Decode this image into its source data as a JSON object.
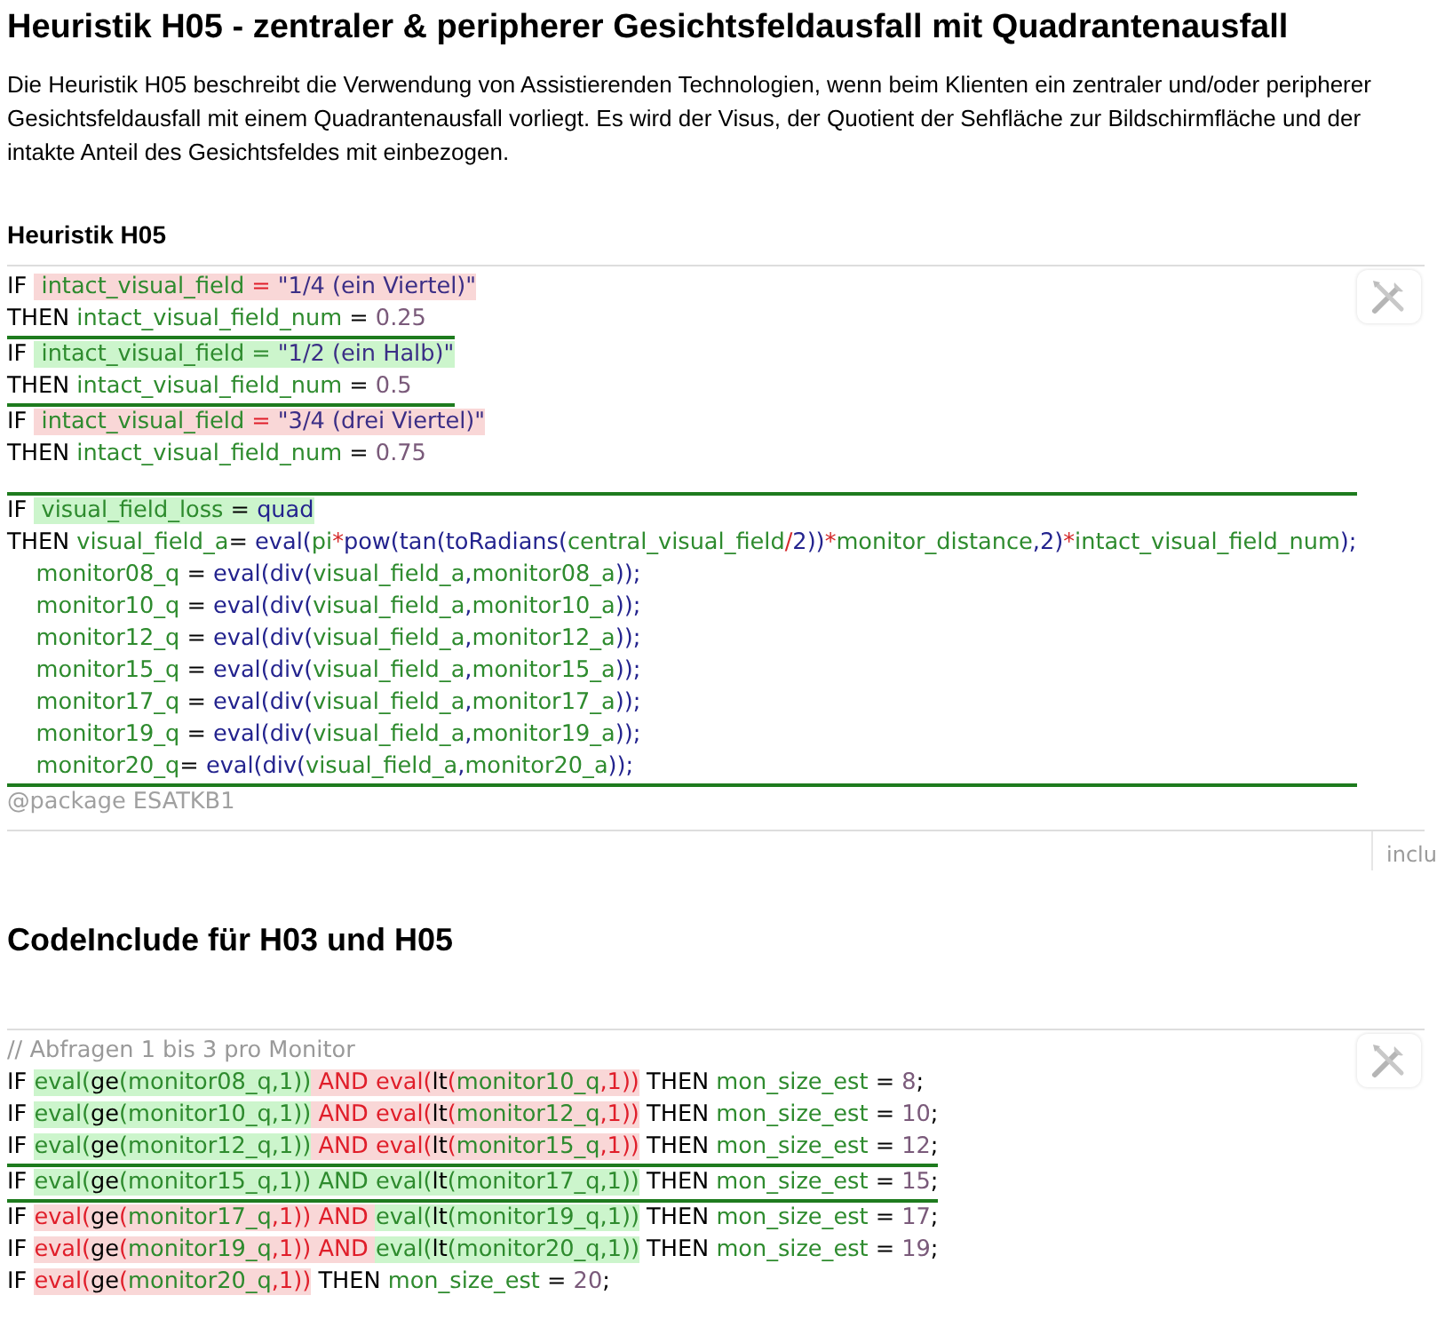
{
  "title": "Heuristik H05 - zentraler & peripherer Gesichtsfeldausfall mit Quadrantenausfall",
  "description": "Die Heuristik H05 beschreibt die Verwendung von Assistierenden Technologien, wenn beim Klienten ein zentraler und/oder peripherer Gesichtsfeldausfall mit einem Quadrantenausfall vorliegt. Es wird der Visus, der Quotient der Sehfläche zur Bildschirmfläche und der intakte Anteil des Gesichtsfeldes mit einbezogen.",
  "sections": [
    {
      "heading": "Heuristik H05",
      "kind": "subheading",
      "tab": "inclu",
      "footer": "@package ESATKB1",
      "blocks": [
        [
          {
            "fired": false,
            "lines": [
              [
                {
                  "text": "IF ",
                  "kind": "keyword"
                },
                {
                  "text": " intact_visual_field",
                  "kind": "variable",
                  "passed": false
                },
                {
                  "text": " = ",
                  "kind": "mark",
                  "passed": false
                },
                {
                  "text": "\"1/4 (ein Viertel)\"",
                  "kind": "string",
                  "passed": false
                }
              ],
              [
                {
                  "text": "THEN ",
                  "kind": "keyword"
                },
                {
                  "text": "intact_visual_field_num",
                  "kind": "variable"
                },
                {
                  "text": " = ",
                  "kind": "keyword"
                },
                {
                  "text": "0.25",
                  "kind": "number"
                }
              ]
            ]
          },
          {
            "fired": true,
            "lines": [
              [
                {
                  "text": "IF ",
                  "kind": "keyword"
                },
                {
                  "text": " intact_visual_field",
                  "kind": "variable",
                  "passed": true
                },
                {
                  "text": " = ",
                  "kind": "mark",
                  "passed": true
                },
                {
                  "text": "\"1/2 (ein Halb)\"",
                  "kind": "string",
                  "passed": true
                }
              ],
              [
                {
                  "text": "THEN ",
                  "kind": "keyword"
                },
                {
                  "text": "intact_visual_field_num",
                  "kind": "variable"
                },
                {
                  "text": " = ",
                  "kind": "keyword"
                },
                {
                  "text": "0.5",
                  "kind": "number"
                }
              ]
            ]
          },
          {
            "fired": false,
            "lines": [
              [
                {
                  "text": "IF ",
                  "kind": "keyword"
                },
                {
                  "text": " intact_visual_field",
                  "kind": "variable",
                  "passed": false
                },
                {
                  "text": " = ",
                  "kind": "mark",
                  "passed": false
                },
                {
                  "text": "\"3/4 (drei Viertel)\"",
                  "kind": "string",
                  "passed": false
                }
              ],
              [
                {
                  "text": "THEN ",
                  "kind": "keyword"
                },
                {
                  "text": "intact_visual_field_num",
                  "kind": "variable"
                },
                {
                  "text": " = ",
                  "kind": "keyword"
                },
                {
                  "text": "0.75",
                  "kind": "number"
                }
              ]
            ]
          }
        ],
        [
          {
            "fired": true,
            "lines": [
              [
                {
                  "text": "IF ",
                  "kind": "keyword"
                },
                {
                  "text": " visual_field_loss",
                  "kind": "variable",
                  "passed": true
                },
                {
                  "text": " = ",
                  "kind": "keyword",
                  "passed": true
                },
                {
                  "text": "quad",
                  "kind": "function",
                  "passed": true
                }
              ],
              [
                {
                  "text": "THEN ",
                  "kind": "keyword"
                },
                {
                  "text": "visual_field_a",
                  "kind": "variable"
                },
                {
                  "text": "= ",
                  "kind": "keyword"
                },
                {
                  "text": "eval(",
                  "kind": "function"
                },
                {
                  "text": "pi",
                  "kind": "variable"
                },
                {
                  "text": "*",
                  "kind": "operator"
                },
                {
                  "text": "pow(tan(toRadians(",
                  "kind": "function"
                },
                {
                  "text": "central_visual_field",
                  "kind": "variable"
                },
                {
                  "text": "/",
                  "kind": "operator"
                },
                {
                  "text": "2))",
                  "kind": "function"
                },
                {
                  "text": "*",
                  "kind": "operator"
                },
                {
                  "text": "monitor_distance",
                  "kind": "variable"
                },
                {
                  "text": ",2)",
                  "kind": "function"
                },
                {
                  "text": "*",
                  "kind": "operator"
                },
                {
                  "text": "intact_visual_field_num",
                  "kind": "variable"
                },
                {
                  "text": ");",
                  "kind": "function"
                }
              ],
              [
                {
                  "text": "    monitor08_q",
                  "kind": "variable"
                },
                {
                  "text": " = ",
                  "kind": "keyword"
                },
                {
                  "text": "eval(div(",
                  "kind": "function"
                },
                {
                  "text": "visual_field_a",
                  "kind": "variable"
                },
                {
                  "text": ",",
                  "kind": "function"
                },
                {
                  "text": "monitor08_a",
                  "kind": "variable"
                },
                {
                  "text": "));",
                  "kind": "function"
                }
              ],
              [
                {
                  "text": "    monitor10_q",
                  "kind": "variable"
                },
                {
                  "text": " = ",
                  "kind": "keyword"
                },
                {
                  "text": "eval(div(",
                  "kind": "function"
                },
                {
                  "text": "visual_field_a",
                  "kind": "variable"
                },
                {
                  "text": ",",
                  "kind": "function"
                },
                {
                  "text": "monitor10_a",
                  "kind": "variable"
                },
                {
                  "text": "));",
                  "kind": "function"
                }
              ],
              [
                {
                  "text": "    monitor12_q",
                  "kind": "variable"
                },
                {
                  "text": " = ",
                  "kind": "keyword"
                },
                {
                  "text": "eval(div(",
                  "kind": "function"
                },
                {
                  "text": "visual_field_a",
                  "kind": "variable"
                },
                {
                  "text": ",",
                  "kind": "function"
                },
                {
                  "text": "monitor12_a",
                  "kind": "variable"
                },
                {
                  "text": "));",
                  "kind": "function"
                }
              ],
              [
                {
                  "text": "    monitor15_q",
                  "kind": "variable"
                },
                {
                  "text": " = ",
                  "kind": "keyword"
                },
                {
                  "text": "eval(div(",
                  "kind": "function"
                },
                {
                  "text": "visual_field_a",
                  "kind": "variable"
                },
                {
                  "text": ",",
                  "kind": "function"
                },
                {
                  "text": "monitor15_a",
                  "kind": "variable"
                },
                {
                  "text": "));",
                  "kind": "function"
                }
              ],
              [
                {
                  "text": "    monitor17_q",
                  "kind": "variable"
                },
                {
                  "text": " = ",
                  "kind": "keyword"
                },
                {
                  "text": "eval(div(",
                  "kind": "function"
                },
                {
                  "text": "visual_field_a",
                  "kind": "variable"
                },
                {
                  "text": ",",
                  "kind": "function"
                },
                {
                  "text": "monitor17_a",
                  "kind": "variable"
                },
                {
                  "text": "));",
                  "kind": "function"
                }
              ],
              [
                {
                  "text": "    monitor19_q",
                  "kind": "variable"
                },
                {
                  "text": " = ",
                  "kind": "keyword"
                },
                {
                  "text": "eval(div(",
                  "kind": "function"
                },
                {
                  "text": "visual_field_a",
                  "kind": "variable"
                },
                {
                  "text": ",",
                  "kind": "function"
                },
                {
                  "text": "monitor19_a",
                  "kind": "variable"
                },
                {
                  "text": "));",
                  "kind": "function"
                }
              ],
              [
                {
                  "text": "    monitor20_q",
                  "kind": "variable"
                },
                {
                  "text": "= ",
                  "kind": "keyword"
                },
                {
                  "text": "eval(div(",
                  "kind": "function"
                },
                {
                  "text": "visual_field_a",
                  "kind": "variable"
                },
                {
                  "text": ",",
                  "kind": "function"
                },
                {
                  "text": "monitor20_a",
                  "kind": "variable"
                },
                {
                  "text": "));",
                  "kind": "function"
                }
              ]
            ]
          }
        ]
      ]
    },
    {
      "heading": "CodeInclude für H03 und H05",
      "kind": "heading",
      "blocks": [
        [
          {
            "fired": false,
            "lines": [
              [
                {
                  "text": "// Abfragen 1 bis 3 pro Monitor",
                  "kind": "comment"
                }
              ],
              [
                {
                  "text": "IF ",
                  "kind": "keyword"
                },
                {
                  "text": "eval(",
                  "kind": "mark",
                  "passed": true
                },
                {
                  "text": "ge",
                  "kind": "keyword",
                  "passed": true
                },
                {
                  "text": "(",
                  "kind": "mark",
                  "passed": true
                },
                {
                  "text": "monitor08_q",
                  "kind": "variable",
                  "passed": true
                },
                {
                  "text": ",1))",
                  "kind": "mark",
                  "passed": true
                },
                {
                  "text": " AND eval(",
                  "kind": "mark",
                  "passed": false
                },
                {
                  "text": "lt",
                  "kind": "keyword",
                  "passed": false
                },
                {
                  "text": "(",
                  "kind": "mark",
                  "passed": false
                },
                {
                  "text": "monitor10_q",
                  "kind": "variable",
                  "passed": false
                },
                {
                  "text": ",1))",
                  "kind": "mark",
                  "passed": false
                },
                {
                  "text": " THEN ",
                  "kind": "keyword"
                },
                {
                  "text": "mon_size_est",
                  "kind": "variable"
                },
                {
                  "text": " = ",
                  "kind": "keyword"
                },
                {
                  "text": "8",
                  "kind": "number"
                },
                {
                  "text": ";",
                  "kind": "keyword"
                }
              ],
              [
                {
                  "text": "IF ",
                  "kind": "keyword"
                },
                {
                  "text": "eval(",
                  "kind": "mark",
                  "passed": true
                },
                {
                  "text": "ge",
                  "kind": "keyword",
                  "passed": true
                },
                {
                  "text": "(",
                  "kind": "mark",
                  "passed": true
                },
                {
                  "text": "monitor10_q",
                  "kind": "variable",
                  "passed": true
                },
                {
                  "text": ",1))",
                  "kind": "mark",
                  "passed": true
                },
                {
                  "text": " AND eval(",
                  "kind": "mark",
                  "passed": false
                },
                {
                  "text": "lt",
                  "kind": "keyword",
                  "passed": false
                },
                {
                  "text": "(",
                  "kind": "mark",
                  "passed": false
                },
                {
                  "text": "monitor12_q",
                  "kind": "variable",
                  "passed": false
                },
                {
                  "text": ",1))",
                  "kind": "mark",
                  "passed": false
                },
                {
                  "text": " THEN ",
                  "kind": "keyword"
                },
                {
                  "text": "mon_size_est",
                  "kind": "variable"
                },
                {
                  "text": " = ",
                  "kind": "keyword"
                },
                {
                  "text": "10",
                  "kind": "number"
                },
                {
                  "text": ";",
                  "kind": "keyword"
                }
              ],
              [
                {
                  "text": "IF ",
                  "kind": "keyword"
                },
                {
                  "text": "eval(",
                  "kind": "mark",
                  "passed": true
                },
                {
                  "text": "ge",
                  "kind": "keyword",
                  "passed": true
                },
                {
                  "text": "(",
                  "kind": "mark",
                  "passed": true
                },
                {
                  "text": "monitor12_q",
                  "kind": "variable",
                  "passed": true
                },
                {
                  "text": ",1))",
                  "kind": "mark",
                  "passed": true
                },
                {
                  "text": " AND eval(",
                  "kind": "mark",
                  "passed": false
                },
                {
                  "text": "lt",
                  "kind": "keyword",
                  "passed": false
                },
                {
                  "text": "(",
                  "kind": "mark",
                  "passed": false
                },
                {
                  "text": "monitor15_q",
                  "kind": "variable",
                  "passed": false
                },
                {
                  "text": ",1))",
                  "kind": "mark",
                  "passed": false
                },
                {
                  "text": " THEN ",
                  "kind": "keyword"
                },
                {
                  "text": "mon_size_est",
                  "kind": "variable"
                },
                {
                  "text": " = ",
                  "kind": "keyword"
                },
                {
                  "text": "12",
                  "kind": "number"
                },
                {
                  "text": ";",
                  "kind": "keyword"
                }
              ]
            ]
          },
          {
            "fired": true,
            "lines": [
              [
                {
                  "text": "IF ",
                  "kind": "keyword"
                },
                {
                  "text": "eval(",
                  "kind": "mark",
                  "passed": true
                },
                {
                  "text": "ge",
                  "kind": "keyword",
                  "passed": true
                },
                {
                  "text": "(",
                  "kind": "mark",
                  "passed": true
                },
                {
                  "text": "monitor15_q",
                  "kind": "variable",
                  "passed": true
                },
                {
                  "text": ",1))",
                  "kind": "mark",
                  "passed": true
                },
                {
                  "text": " AND eval(",
                  "kind": "mark",
                  "passed": true
                },
                {
                  "text": "lt",
                  "kind": "keyword",
                  "passed": true
                },
                {
                  "text": "(",
                  "kind": "mark",
                  "passed": true
                },
                {
                  "text": "monitor17_q",
                  "kind": "variable",
                  "passed": true
                },
                {
                  "text": ",1))",
                  "kind": "mark",
                  "passed": true
                },
                {
                  "text": " THEN ",
                  "kind": "keyword"
                },
                {
                  "text": "mon_size_est",
                  "kind": "variable"
                },
                {
                  "text": " = ",
                  "kind": "keyword"
                },
                {
                  "text": "15",
                  "kind": "number"
                },
                {
                  "text": ";",
                  "kind": "keyword"
                }
              ]
            ]
          },
          {
            "fired": false,
            "lines": [
              [
                {
                  "text": "IF ",
                  "kind": "keyword"
                },
                {
                  "text": "eval(",
                  "kind": "mark",
                  "passed": false
                },
                {
                  "text": "ge",
                  "kind": "keyword",
                  "passed": false
                },
                {
                  "text": "(",
                  "kind": "mark",
                  "passed": false
                },
                {
                  "text": "monitor17_q",
                  "kind": "variable",
                  "passed": false
                },
                {
                  "text": ",1))",
                  "kind": "mark",
                  "passed": false
                },
                {
                  "text": " AND ",
                  "kind": "mark",
                  "passed": false
                },
                {
                  "text": "eval(",
                  "kind": "mark",
                  "passed": true
                },
                {
                  "text": "lt",
                  "kind": "keyword",
                  "passed": true
                },
                {
                  "text": "(",
                  "kind": "mark",
                  "passed": true
                },
                {
                  "text": "monitor19_q",
                  "kind": "variable",
                  "passed": true
                },
                {
                  "text": ",1))",
                  "kind": "mark",
                  "passed": true
                },
                {
                  "text": " THEN ",
                  "kind": "keyword"
                },
                {
                  "text": "mon_size_est",
                  "kind": "variable"
                },
                {
                  "text": " = ",
                  "kind": "keyword"
                },
                {
                  "text": "17",
                  "kind": "number"
                },
                {
                  "text": ";",
                  "kind": "keyword"
                }
              ],
              [
                {
                  "text": "IF ",
                  "kind": "keyword"
                },
                {
                  "text": "eval(",
                  "kind": "mark",
                  "passed": false
                },
                {
                  "text": "ge",
                  "kind": "keyword",
                  "passed": false
                },
                {
                  "text": "(",
                  "kind": "mark",
                  "passed": false
                },
                {
                  "text": "monitor19_q",
                  "kind": "variable",
                  "passed": false
                },
                {
                  "text": ",1))",
                  "kind": "mark",
                  "passed": false
                },
                {
                  "text": " AND ",
                  "kind": "mark",
                  "passed": false
                },
                {
                  "text": "eval(",
                  "kind": "mark",
                  "passed": true
                },
                {
                  "text": "lt",
                  "kind": "keyword",
                  "passed": true
                },
                {
                  "text": "(",
                  "kind": "mark",
                  "passed": true
                },
                {
                  "text": "monitor20_q",
                  "kind": "variable",
                  "passed": true
                },
                {
                  "text": ",1))",
                  "kind": "mark",
                  "passed": true
                },
                {
                  "text": " THEN ",
                  "kind": "keyword"
                },
                {
                  "text": "mon_size_est",
                  "kind": "variable"
                },
                {
                  "text": " = ",
                  "kind": "keyword"
                },
                {
                  "text": "19",
                  "kind": "number"
                },
                {
                  "text": ";",
                  "kind": "keyword"
                }
              ],
              [
                {
                  "text": "IF ",
                  "kind": "keyword"
                },
                {
                  "text": "eval(",
                  "kind": "mark",
                  "passed": false
                },
                {
                  "text": "ge",
                  "kind": "keyword",
                  "passed": false
                },
                {
                  "text": "(",
                  "kind": "mark",
                  "passed": false
                },
                {
                  "text": "monitor20_q",
                  "kind": "variable",
                  "passed": false
                },
                {
                  "text": ",1))",
                  "kind": "mark",
                  "passed": false
                },
                {
                  "text": " THEN ",
                  "kind": "keyword"
                },
                {
                  "text": "mon_size_est",
                  "kind": "variable"
                },
                {
                  "text": " = ",
                  "kind": "keyword"
                },
                {
                  "text": "20",
                  "kind": "number"
                },
                {
                  "text": ";",
                  "kind": "keyword"
                }
              ]
            ]
          }
        ]
      ]
    }
  ]
}
